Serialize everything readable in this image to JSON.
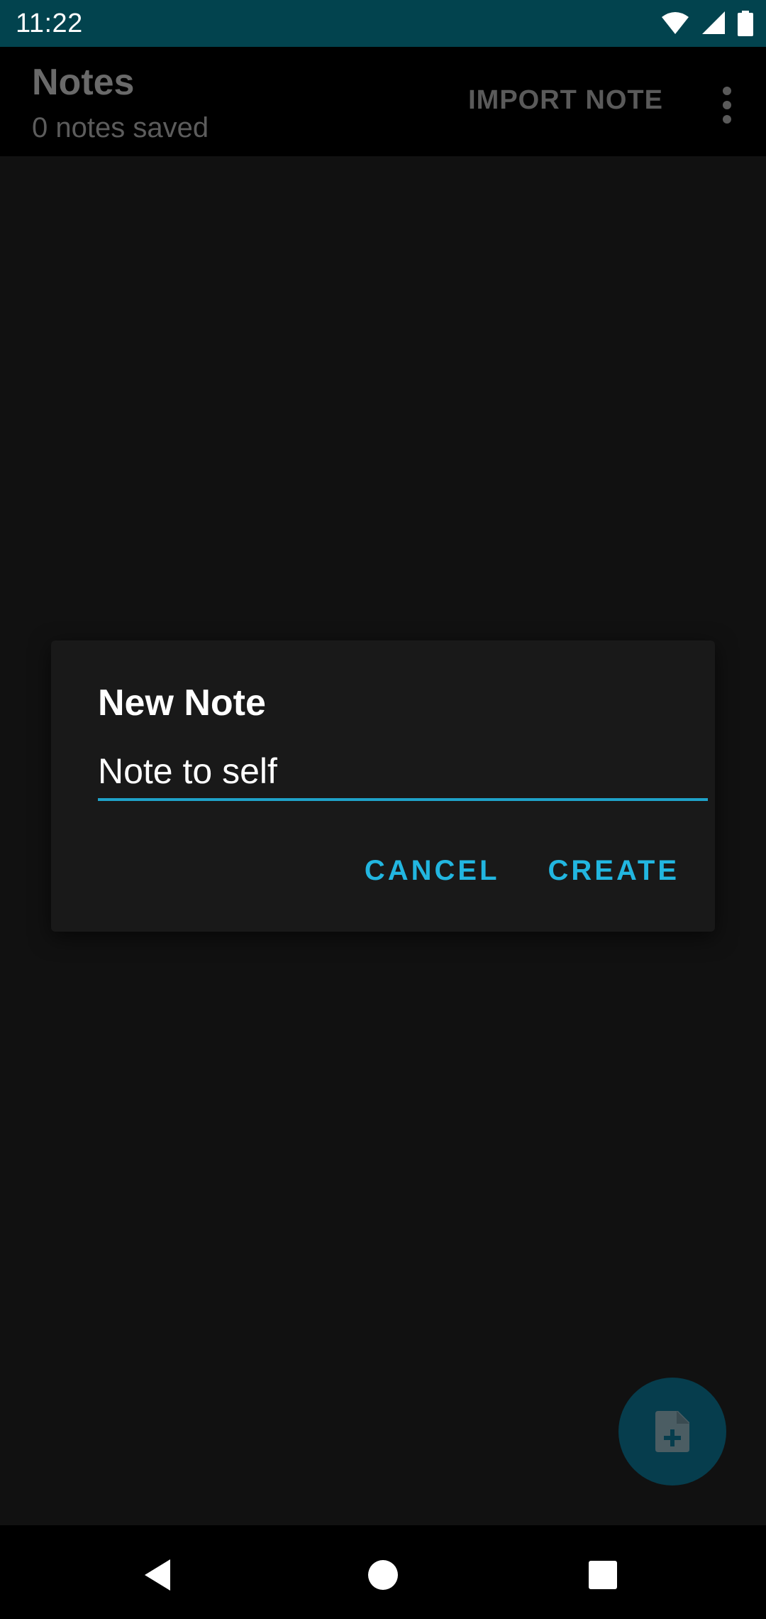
{
  "status_bar": {
    "time": "11:22",
    "icons": [
      "wifi-icon",
      "signal-icon",
      "battery-icon"
    ]
  },
  "app_bar": {
    "title": "Notes",
    "subtitle": "0 notes saved",
    "import_label": "IMPORT NOTE",
    "overflow_icon": "more-vert-icon"
  },
  "dialog": {
    "title": "New Note",
    "input_value": "Note to self",
    "cancel_label": "CANCEL",
    "create_label": "CREATE"
  },
  "fab": {
    "icon": "note-add-icon"
  },
  "nav_bar": {
    "icons": [
      "back-icon",
      "home-icon",
      "recents-icon"
    ]
  },
  "colors": {
    "status_bar": "#02434e",
    "accent": "#22b6e0",
    "underline": "#1fa2c9",
    "fab": "#063d4d",
    "background": "#111111"
  }
}
